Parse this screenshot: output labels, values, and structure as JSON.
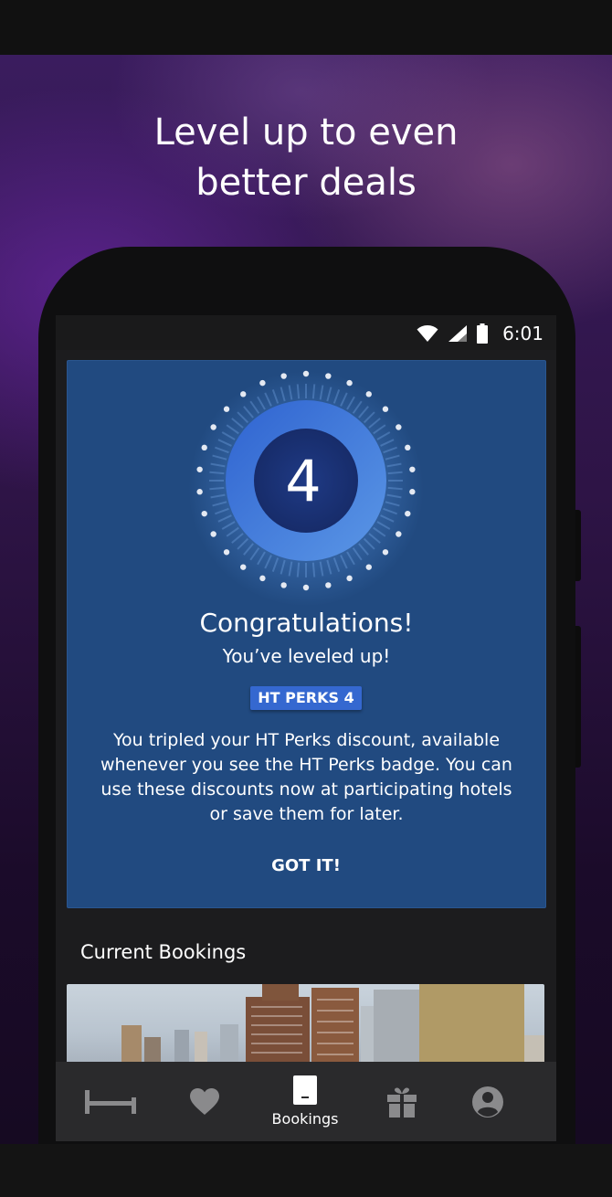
{
  "hero": {
    "title": "Level up to even\nbetter deals"
  },
  "status_bar": {
    "time": "6:01",
    "icons": [
      "wifi-icon",
      "cell-signal-icon",
      "battery-icon"
    ]
  },
  "level_card": {
    "level_number": "4",
    "title": "Congratulations!",
    "subtitle": "You’ve leveled up!",
    "badge_label": "HT PERKS 4",
    "description": "You tripled your HT Perks discount, available whenever you see the HT Perks badge. You can use these discounts now at participating hotels or save them for later.",
    "action_label": "GOT IT!"
  },
  "current_bookings": {
    "title": "Current Bookings"
  },
  "bottom_nav": {
    "items": [
      {
        "icon": "bed-icon",
        "label": "",
        "active": false
      },
      {
        "icon": "heart-icon",
        "label": "",
        "active": false
      },
      {
        "icon": "bookings-icon",
        "label": "Bookings",
        "active": true
      },
      {
        "icon": "gift-icon",
        "label": "",
        "active": false
      },
      {
        "icon": "account-icon",
        "label": "",
        "active": false
      }
    ]
  },
  "colors": {
    "card_bg": "#214a80",
    "badge_bg": "#3568d0",
    "ring_start": "#2f63d0",
    "ring_end": "#5b97e6",
    "nav_icon_inactive": "#8a8a8c",
    "nav_icon_active": "#ffffff"
  }
}
